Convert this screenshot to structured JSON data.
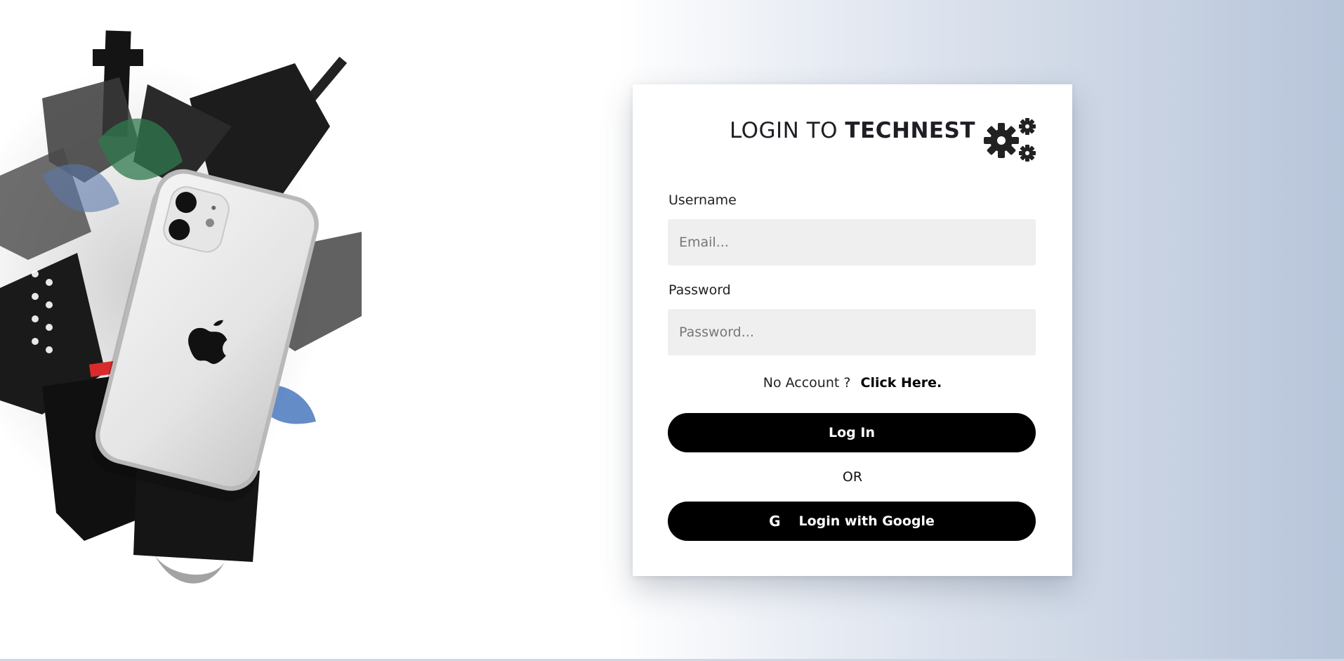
{
  "login": {
    "title_prefix": "LOGIN TO",
    "title_brand": "TECHNEST",
    "username_label": "Username",
    "username_placeholder": "Email...",
    "password_label": "Password",
    "password_placeholder": "Password...",
    "no_account_text": "No Account ?",
    "signup_link": "Click Here.",
    "login_button": "Log In",
    "or_text": "OR",
    "google_icon": "G",
    "google_button": "Login with Google"
  },
  "icons": {
    "settings": "gears-icon",
    "google": "google-icon",
    "hero": "phone-collage-illustration"
  },
  "colors": {
    "button_bg": "#000000",
    "button_text": "#ffffff",
    "field_bg": "#efefef",
    "gradient_end": "#b7c5da"
  }
}
